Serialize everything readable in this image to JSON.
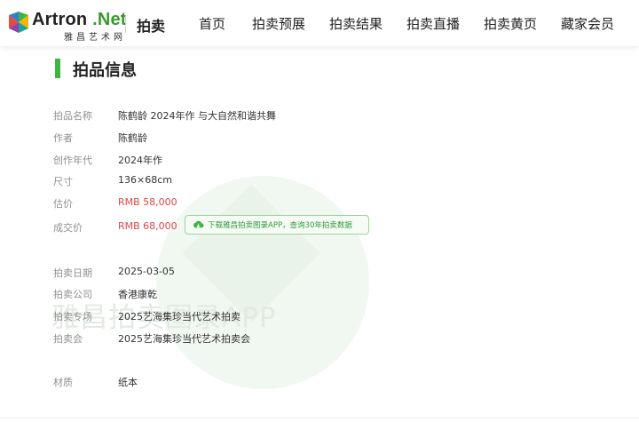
{
  "logo": {
    "name_main": "Artron",
    "name_net": ".Net",
    "subtitle": "雅昌艺术网"
  },
  "header": {
    "section_title": "拍卖",
    "nav": [
      "首页",
      "拍卖预展",
      "拍卖结果",
      "拍卖直播",
      "拍卖黄页",
      "藏家会员"
    ]
  },
  "page": {
    "title": "拍品信息"
  },
  "details": {
    "name": {
      "label": "拍品名称",
      "value": "陈鹤龄 2024年作 与大自然和谐共舞"
    },
    "author": {
      "label": "作者",
      "value": "陈鹤龄"
    },
    "year": {
      "label": "创作年代",
      "value": "2024年作"
    },
    "size": {
      "label": "尺寸",
      "value": "136×68cm"
    },
    "estimate": {
      "label": "估价",
      "value": "RMB 58,000"
    },
    "price": {
      "label": "成交价",
      "value": "RMB 68,000"
    },
    "app_button": "下载雅昌拍卖图录APP，查询30年拍卖数据",
    "date": {
      "label": "拍卖日期",
      "value": "2025-03-05"
    },
    "company": {
      "label": "拍卖公司",
      "value": "香港康乾"
    },
    "session": {
      "label": "拍卖专场",
      "value": "2025艺海集珍当代艺术拍卖"
    },
    "auction": {
      "label": "拍卖会",
      "value": "2025艺海集珍当代艺术拍卖会"
    },
    "material": {
      "label": "材质",
      "value": "纸本"
    }
  },
  "watermark": {
    "text": "雅昌拍卖图录APP"
  },
  "colors": {
    "accent_green": "#3db540",
    "price_red": "#e0464a"
  }
}
